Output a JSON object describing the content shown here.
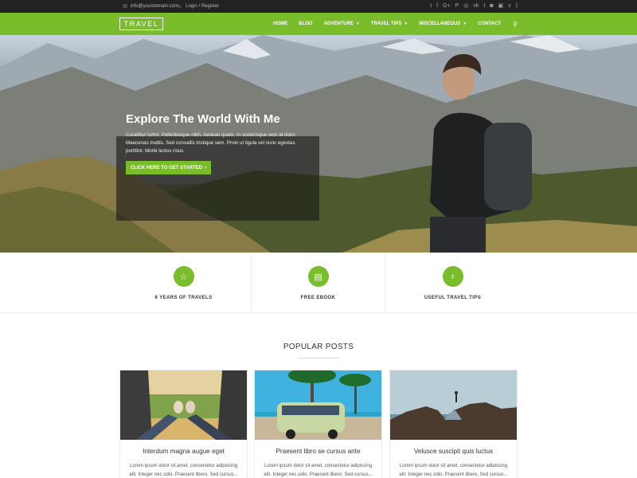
{
  "topbar": {
    "email": "info@yourdomain.com",
    "login": "Login / Register",
    "social": [
      "twitter-icon",
      "facebook-icon",
      "google-plus-icon",
      "pinterest-icon",
      "dribbble-icon",
      "vk-icon",
      "tumblr-icon",
      "instagram-icon",
      "foursquare-icon",
      "vimeo-icon",
      "rss-icon"
    ]
  },
  "nav": {
    "logo": "TRAVEL",
    "items": [
      {
        "label": "HOME",
        "caret": false
      },
      {
        "label": "BLOG",
        "caret": false
      },
      {
        "label": "ADVENTURE",
        "caret": true
      },
      {
        "label": "TRAVEL TIPS",
        "caret": true
      },
      {
        "label": "MISCELLANEOUS",
        "caret": true
      },
      {
        "label": "CONTACT",
        "caret": false
      }
    ]
  },
  "hero": {
    "title": "Explore The World With Me",
    "text": "Curabitur tortor. Pellentesque nibh. Aenean quam. In scelerisque sem at dolor. Maecenas mattis. Sed convallis tristique sem. Proin ut ligula vel nunc egestas porttitor. Morbi lectus risus.",
    "button": "CLICK HERE TO GET STARTED"
  },
  "features": [
    {
      "label": "6 YEARS OF TRAVELS",
      "icon": "star-icon"
    },
    {
      "label": "FREE EBOOK",
      "icon": "book-icon"
    },
    {
      "label": "USEFUL TRAVEL TIPS",
      "icon": "lightbulb-icon"
    }
  ],
  "posts": {
    "section_title": "POPULAR POSTS",
    "items": [
      {
        "title": "Interdum magna augue eget",
        "excerpt": "Lorem ipsum dolor sit amet, consectetur adipiscing elit. Integer nec odio. Praesent libero. Sed cursus..."
      },
      {
        "title": "Praesent libro se cursus ante",
        "excerpt": "Lorem ipsum dolor sit amet, consectetur adipiscing elit. Integer nec odio. Praesent libero. Sed cursus..."
      },
      {
        "title": "Velusce suscipit quis luctus",
        "excerpt": "Lorem ipsum dolor sit amet, consectetur adipiscing elit. Integer nec odio. Praesent libero. Sed cursus..."
      }
    ]
  },
  "colors": {
    "accent": "#79bd2b",
    "topbar": "#222222"
  }
}
